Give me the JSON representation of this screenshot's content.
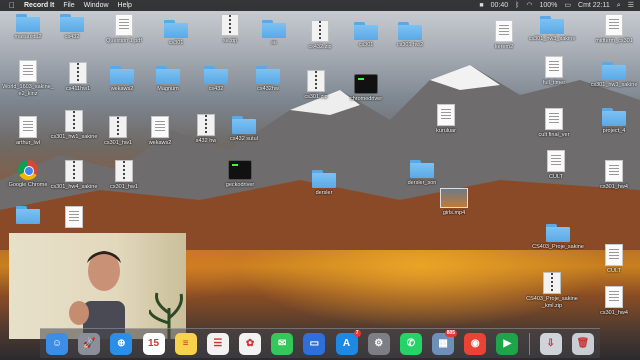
{
  "menubar": {
    "app_name": "Record It",
    "menus": [
      "File",
      "Window",
      "Help"
    ],
    "status": {
      "time_elapsed": "00:40",
      "battery": "100%",
      "clock": "Cmt 22:11"
    }
  },
  "desktop": {
    "icons": [
      {
        "label": "masaustu2",
        "kind": "folder"
      },
      {
        "label": "cs432",
        "kind": "folder"
      },
      {
        "label": "Question 1.pdf",
        "kind": "doc"
      },
      {
        "label": "cs301",
        "kind": "folder"
      },
      {
        "label": "se.zip",
        "kind": "archive"
      },
      {
        "label": "se",
        "kind": "folder"
      },
      {
        "label": "cs432.zip",
        "kind": "archive"
      },
      {
        "label": "cs301",
        "kind": "folder"
      },
      {
        "label": "cs301 hw2",
        "kind": "folder"
      },
      {
        "label": "kerem2",
        "kind": "doc"
      },
      {
        "label": "cs301_hw3_sakine",
        "kind": "folder"
      },
      {
        "label": "midterm_cs301",
        "kind": "doc"
      },
      {
        "label": "World_1603_sakine_e2_kinz",
        "kind": "doc"
      },
      {
        "label": "cs411hw1",
        "kind": "archive"
      },
      {
        "label": "wekaws2",
        "kind": "folder"
      },
      {
        "label": "Magnum",
        "kind": "folder"
      },
      {
        "label": "cs432",
        "kind": "folder"
      },
      {
        "label": "cs432hw",
        "kind": "folder"
      },
      {
        "label": "cs301.zip",
        "kind": "archive"
      },
      {
        "label": "chromedriver",
        "kind": "terminal"
      },
      {
        "label": "full_timer",
        "kind": "doc"
      },
      {
        "label": "cs301_hw3_sakine",
        "kind": "folder"
      },
      {
        "label": "arthur_lwl",
        "kind": "doc"
      },
      {
        "label": "cs301_hw1_sakine",
        "kind": "archive"
      },
      {
        "label": "cs301_hw1",
        "kind": "archive"
      },
      {
        "label": "wekaws2",
        "kind": "doc"
      },
      {
        "label": "s432 hw",
        "kind": "archive"
      },
      {
        "label": "cs432 sutul",
        "kind": "folder"
      },
      {
        "label": "kuruluar",
        "kind": "doc"
      },
      {
        "label": "cult final_ver",
        "kind": "doc"
      },
      {
        "label": "project_4",
        "kind": "folder"
      },
      {
        "label": "Google Chrome",
        "kind": "chrome"
      },
      {
        "label": "cs301_hw4_sakine",
        "kind": "archive"
      },
      {
        "label": "cs301_hw1",
        "kind": "archive"
      },
      {
        "label": "geckodriver",
        "kind": "terminal"
      },
      {
        "label": "dersler",
        "kind": "folder"
      },
      {
        "label": "dersler_son",
        "kind": "folder"
      },
      {
        "label": "CULT",
        "kind": "doc"
      },
      {
        "label": "cs301_hw4",
        "kind": "doc"
      },
      {
        "label": "girls.mp4",
        "kind": "image"
      },
      {
        "label": "",
        "kind": "folder"
      },
      {
        "label": "",
        "kind": "doc"
      },
      {
        "label": "CS403_Proje_sakine",
        "kind": "folder"
      },
      {
        "label": "CULT",
        "kind": "doc"
      },
      {
        "label": "CS403_Proje_sakine_kml.zip",
        "kind": "archive"
      },
      {
        "label": "cs301_hw4",
        "kind": "doc"
      }
    ]
  },
  "dock": {
    "apps": [
      {
        "name": "finder-app",
        "glyph": "☺",
        "color": "#3b8de6"
      },
      {
        "name": "launchpad-app",
        "glyph": "🚀",
        "color": "#8a8f99"
      },
      {
        "name": "safari-app",
        "glyph": "⊕",
        "color": "#2b8ee8"
      },
      {
        "name": "calendar-app",
        "glyph": "15",
        "color": "#ffffff"
      },
      {
        "name": "notes-app",
        "glyph": "≡",
        "color": "#f6d34a"
      },
      {
        "name": "reminders-app",
        "glyph": "☰",
        "color": "#f2f2f2"
      },
      {
        "name": "photos-app",
        "glyph": "✿",
        "color": "#f2f2f2"
      },
      {
        "name": "messages-app",
        "glyph": "✉",
        "color": "#34c759"
      },
      {
        "name": "keynote-app",
        "glyph": "▭",
        "color": "#2f6fdb"
      },
      {
        "name": "app-store-app",
        "glyph": "A",
        "color": "#1e88e5",
        "badge": "7"
      },
      {
        "name": "system-preferences-app",
        "glyph": "⚙",
        "color": "#7c7f86"
      },
      {
        "name": "whatsapp-app",
        "glyph": "✆",
        "color": "#25d366"
      },
      {
        "name": "preview-app",
        "glyph": "▦",
        "color": "#6d8fb8",
        "badge": "805"
      },
      {
        "name": "chrome-app",
        "glyph": "◉",
        "color": "#ea4335"
      },
      {
        "name": "facetime-app",
        "glyph": "▶",
        "color": "#1ea54a"
      },
      {
        "name": "downloads-stack",
        "glyph": "⇩",
        "color": "#cfd4da"
      },
      {
        "name": "trash-app",
        "glyph": "🗑",
        "color": "#c9ced4"
      }
    ]
  }
}
